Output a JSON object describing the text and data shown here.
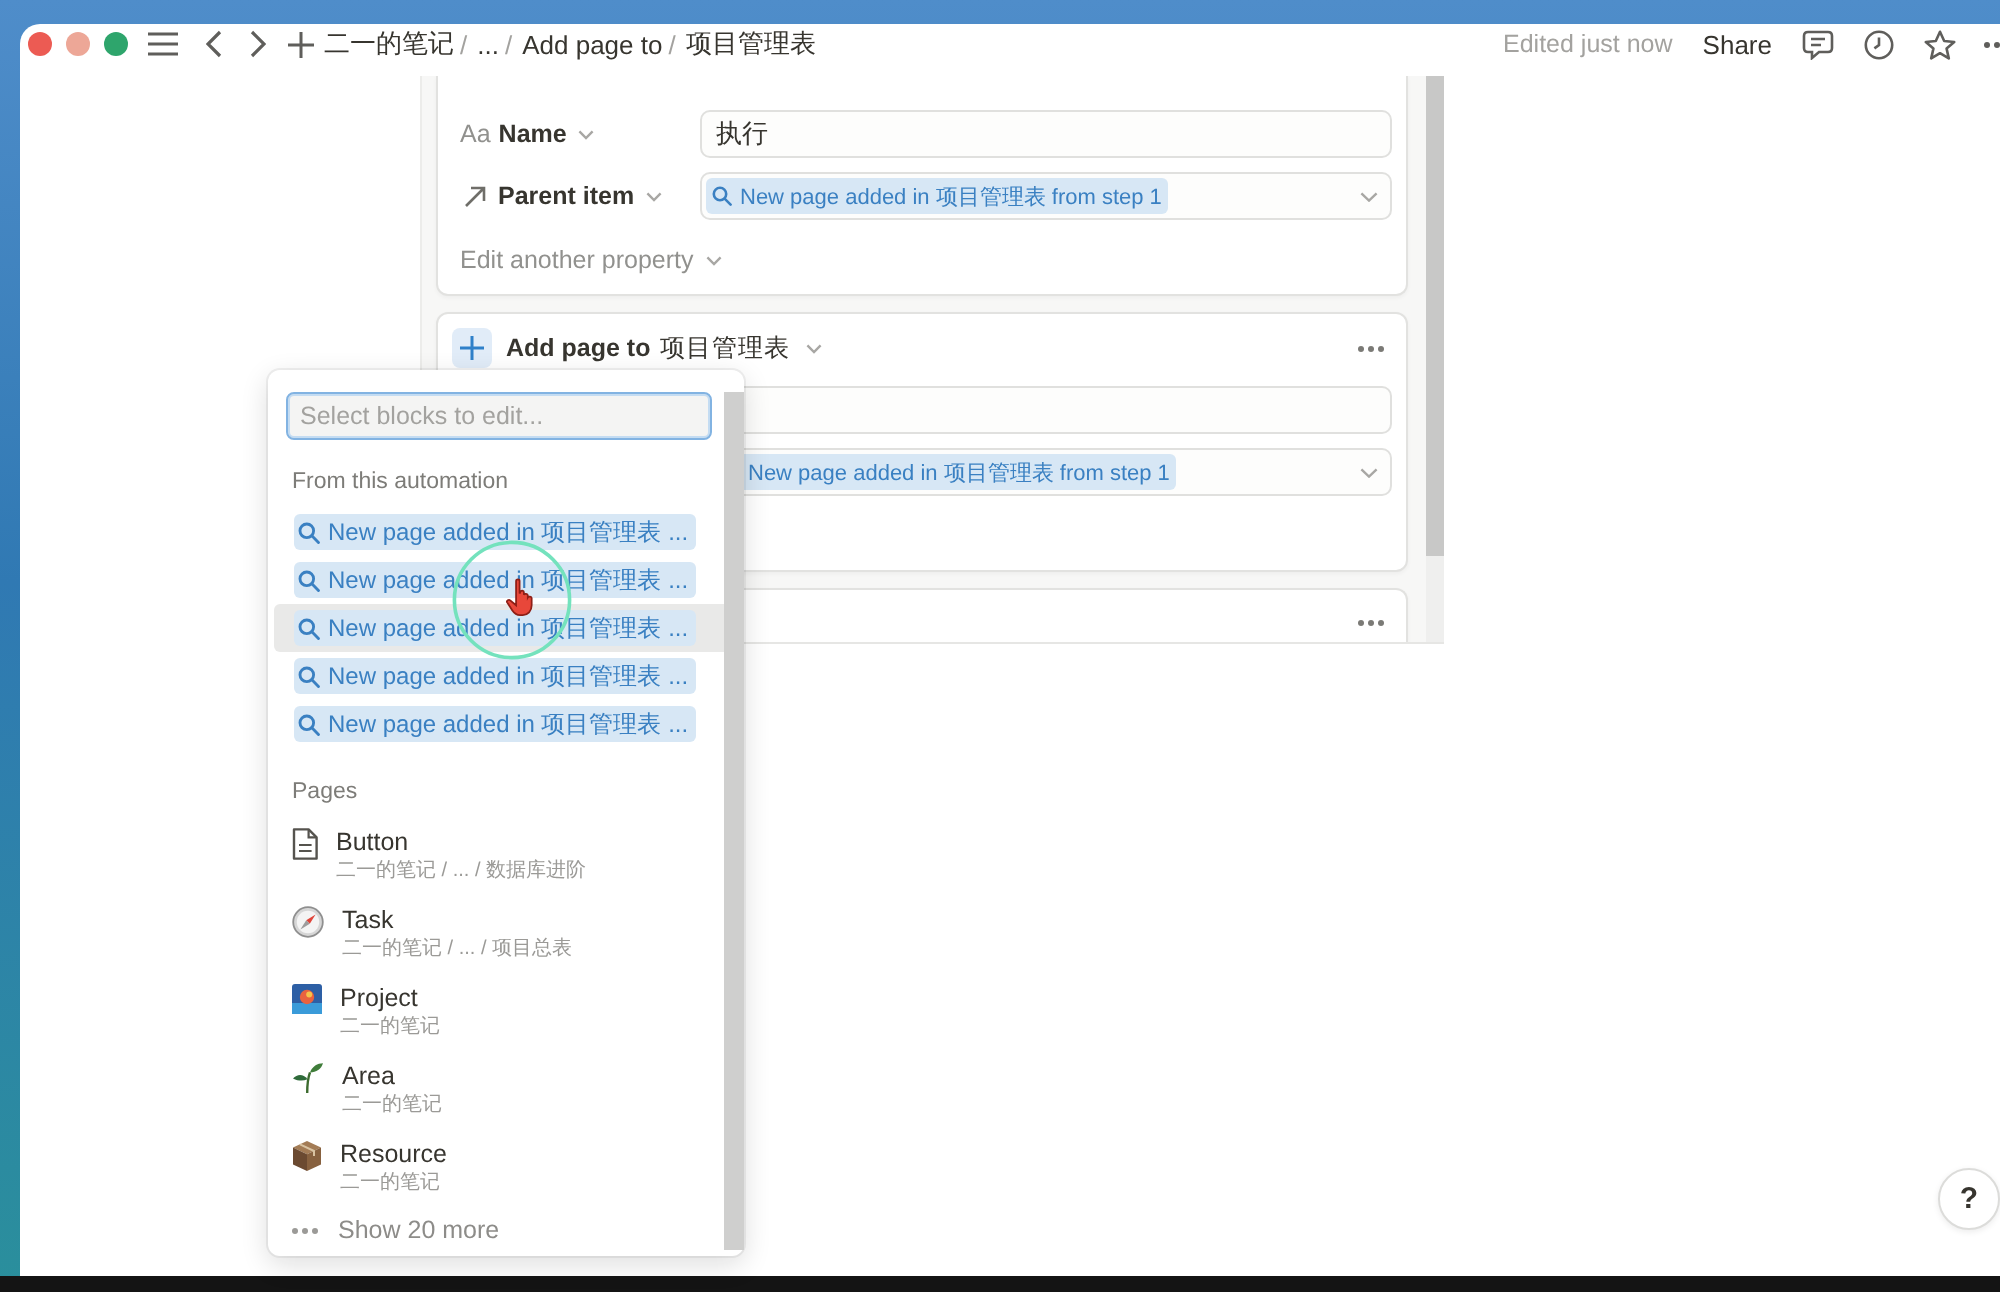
{
  "window": {
    "breadcrumbs": [
      {
        "label": "二一的笔记",
        "separator": "/"
      },
      {
        "label": "...",
        "separator": "/"
      },
      {
        "label": "Add page to",
        "separator": "/"
      },
      {
        "label": "项目管理表"
      }
    ],
    "status": "Edited just now",
    "share": "Share"
  },
  "editor": {
    "cards": [
      {
        "more_menu": false,
        "properties": [
          {
            "kind": "text",
            "glyph": "Aa",
            "label": "Name",
            "value": "执行"
          },
          {
            "kind": "relation",
            "label": "Parent item",
            "chip": "New page added in 项目管理表 from step 1"
          }
        ],
        "edit_more": "Edit another property"
      },
      {
        "more_menu": true,
        "header": {
          "action": "Add page to",
          "target": "项目管理表"
        },
        "properties": [
          {
            "kind": "text"
          },
          {
            "kind": "relation",
            "chip": "New page added in 项目管理表 from step 1"
          }
        ]
      },
      {
        "more_menu": true
      }
    ]
  },
  "block_picker": {
    "search": {
      "placeholder": "Select blocks to edit..."
    },
    "sections": [
      {
        "title": "From this automation",
        "items": [
          {
            "kind": "variable",
            "label": "New page added in 项目管理表 ...",
            "selected": false
          },
          {
            "kind": "variable",
            "label": "New page added in 项目管理表 ...",
            "selected": false
          },
          {
            "kind": "variable",
            "label": "New page added in 项目管理表 ...",
            "selected": true
          },
          {
            "kind": "variable",
            "label": "New page added in 项目管理表 ...",
            "selected": false
          },
          {
            "kind": "variable",
            "label": "New page added in 项目管理表 ...",
            "selected": false
          }
        ]
      },
      {
        "title": "Pages",
        "items": [
          {
            "kind": "page",
            "title": "Button",
            "path": "二一的笔记 / ... / 数据库进阶",
            "selected": false
          },
          {
            "kind": "page",
            "title": "Task",
            "path": "二一的笔记 / ... / 项目总表",
            "selected": false
          },
          {
            "kind": "page",
            "title": "Project",
            "path": "二一的笔记",
            "selected": false
          },
          {
            "kind": "page",
            "title": "Area",
            "path": "二一的笔记",
            "selected": false
          },
          {
            "kind": "page",
            "title": "Resource",
            "path": "二一的笔记",
            "selected": false
          }
        ]
      }
    ],
    "show_more": "Show 20 more"
  },
  "help": "?"
}
